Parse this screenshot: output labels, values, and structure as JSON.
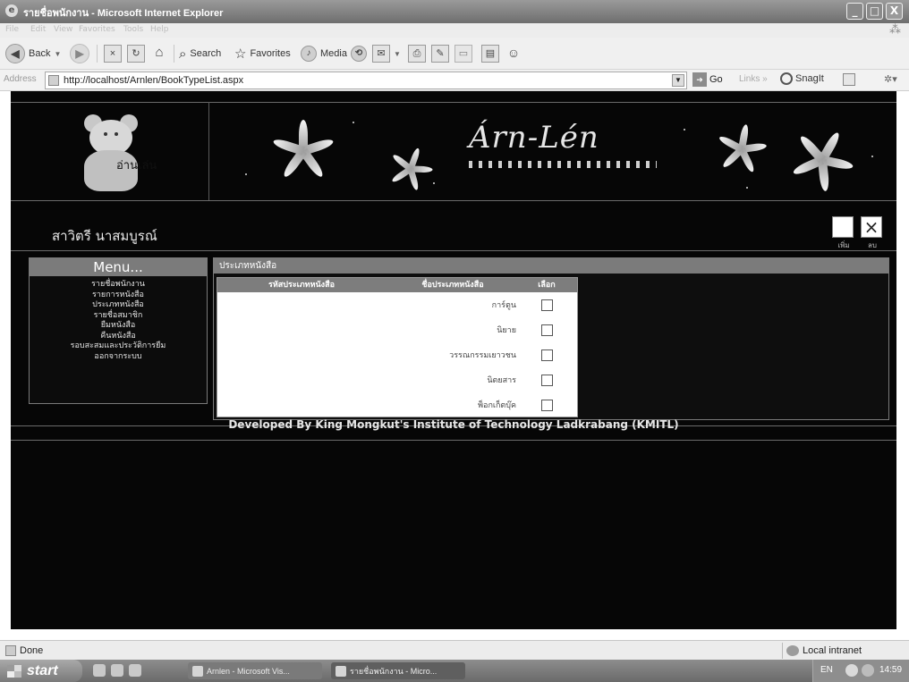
{
  "window": {
    "title": "รายชื่อพนักงาน - Microsoft Internet Explorer",
    "controls": {
      "minimize": "_",
      "maximize": "□",
      "close": "X"
    }
  },
  "menubar": {
    "items": [
      "File",
      "Edit",
      "View",
      "Favorites",
      "Tools",
      "Help"
    ]
  },
  "toolbar": {
    "back_label": "Back",
    "search_label": "Search",
    "favorites_label": "Favorites",
    "media_label": "Media"
  },
  "address": {
    "label": "Address",
    "url": "http://localhost/Arnlen/BookTypeList.aspx",
    "go_label": "Go",
    "links_label": "Links",
    "chevron": "»",
    "snagit_label": "SnagIt"
  },
  "site": {
    "logo_text": "อ่านเล่น",
    "banner_title": "Árn-Lén",
    "user_name": "สาวิตรี นาสมบูรณ์",
    "actions": {
      "add_label": "เพิ่ม",
      "delete_label": "ลบ",
      "delete_glyph": "×"
    }
  },
  "menu": {
    "title": "Menu...",
    "items": [
      "รายชื่อพนักงาน",
      "รายการหนังสือ",
      "ประเภทหนังสือ",
      "รายชื่อสมาชิก",
      "ยืมหนังสือ",
      "คืนหนังสือ",
      "รอบสะสมและประวัติการยืม",
      "ออกจากระบบ"
    ]
  },
  "content": {
    "title": "ประเภทหนังสือ",
    "columns": [
      "รหัสประเภทหนังสือ",
      "ชื่อประเภทหนังสือ",
      "เลือก"
    ],
    "rows": [
      {
        "code": "",
        "name": "การ์ตูน"
      },
      {
        "code": "",
        "name": "นิยาย"
      },
      {
        "code": "",
        "name": "วรรณกรรมเยาวชน"
      },
      {
        "code": "",
        "name": "นิตยสาร"
      },
      {
        "code": "",
        "name": "พ็อกเก็ตบุ๊ค"
      }
    ]
  },
  "footer": {
    "credit": "Developed By King Mongkut's Institute of Technology Ladkrabang (KMITL)"
  },
  "status": {
    "left": "Done",
    "zone": "Local intranet"
  },
  "taskbar": {
    "start_label": "start",
    "tasks": [
      "Arnlen - Microsoft Vis...",
      "รายชื่อพนักงาน - Micro..."
    ],
    "language": "EN",
    "clock": "14:59"
  },
  "colors": {
    "page_bg": "#060606",
    "panel_header": "#7b7b7b",
    "titlebar": "#7a7a7a"
  }
}
